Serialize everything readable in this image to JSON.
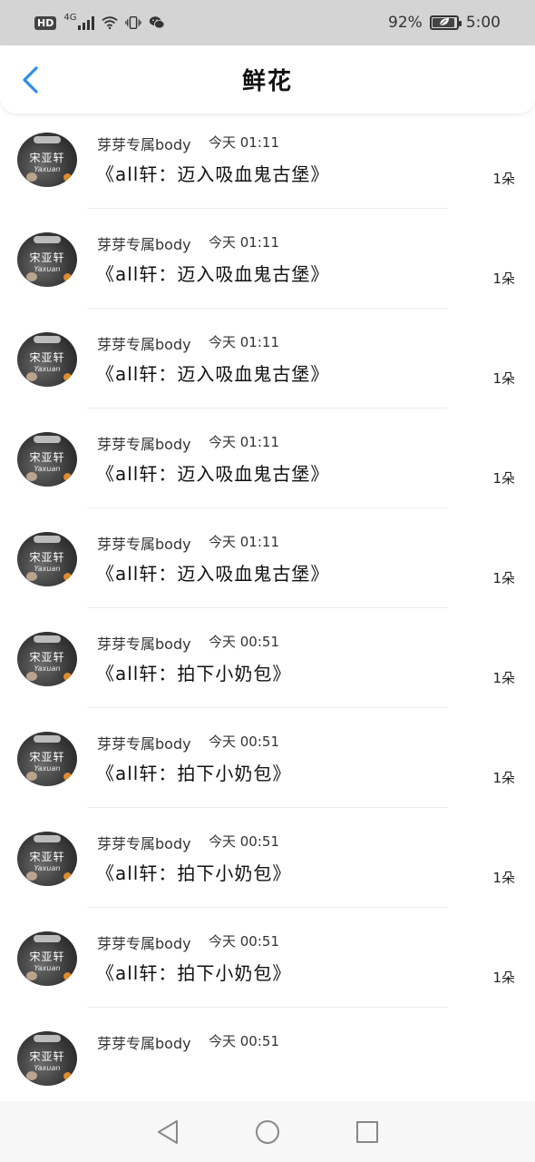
{
  "status_bar": {
    "hd": "HD",
    "network": "4G",
    "battery_percent_text": "92%",
    "battery_level": 0.92,
    "time": "5:00",
    "icons": [
      "signal-icon",
      "wifi-icon",
      "vibrate-icon",
      "wechat-icon",
      "battery-icon"
    ]
  },
  "header": {
    "title": "鲜花",
    "back_icon": "back-icon",
    "accent_color": "#2d8de8"
  },
  "list": {
    "items": [
      {
        "sender": "",
        "time": "",
        "gift": "《all轩：迈入吸血鬼古堡》",
        "count": "1朵"
      },
      {
        "sender": "芽芽专属body",
        "time": "今天 01:11",
        "gift": "《all轩：迈入吸血鬼古堡》",
        "count": "1朵"
      },
      {
        "sender": "芽芽专属body",
        "time": "今天 01:11",
        "gift": "《all轩：迈入吸血鬼古堡》",
        "count": "1朵"
      },
      {
        "sender": "芽芽专属body",
        "time": "今天 01:11",
        "gift": "《all轩：迈入吸血鬼古堡》",
        "count": "1朵"
      },
      {
        "sender": "芽芽专属body",
        "time": "今天 01:11",
        "gift": "《all轩：迈入吸血鬼古堡》",
        "count": "1朵"
      },
      {
        "sender": "芽芽专属body",
        "time": "今天 01:11",
        "gift": "《all轩：迈入吸血鬼古堡》",
        "count": "1朵"
      },
      {
        "sender": "芽芽专属body",
        "time": "今天 00:51",
        "gift": "《all轩：拍下小奶包》",
        "count": "1朵"
      },
      {
        "sender": "芽芽专属body",
        "time": "今天 00:51",
        "gift": "《all轩：拍下小奶包》",
        "count": "1朵"
      },
      {
        "sender": "芽芽专属body",
        "time": "今天 00:51",
        "gift": "《all轩：拍下小奶包》",
        "count": "1朵"
      },
      {
        "sender": "芽芽专属body",
        "time": "今天 00:51",
        "gift": "《all轩：拍下小奶包》",
        "count": "1朵"
      },
      {
        "sender": "芽芽专属body",
        "time": "今天 00:51",
        "gift": "",
        "count": ""
      }
    ],
    "avatar_text": "宋亚轩",
    "avatar_subtext": "Yaxuan"
  },
  "nav_bar": {
    "icons": [
      "nav-back-icon",
      "nav-home-icon",
      "nav-recent-icon"
    ]
  }
}
